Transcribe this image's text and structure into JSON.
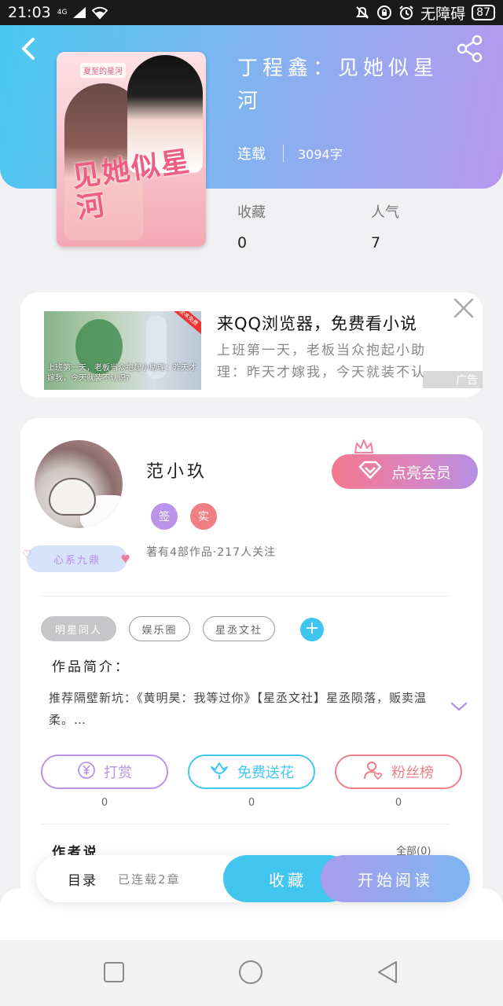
{
  "status_bar": {
    "time": "21:03",
    "network": "4G",
    "accessibility_label": "无障碍",
    "battery": "87"
  },
  "book": {
    "title": "丁程鑫：见她似星河",
    "status": "连载",
    "word_count": "3094字",
    "cover_title": "见她似星河",
    "cover_tag": "夏至的星河"
  },
  "stats": [
    {
      "label": "收藏",
      "value": "0"
    },
    {
      "label": "人气",
      "value": "7"
    }
  ],
  "ad": {
    "title": "来QQ浏览器，免费看小说",
    "description": "上班第一天，老板当众抱起小助理：昨天才嫁我，今天就装不认识?",
    "image_caption": "上班第一天，老板当众抱起小助理：昨天才嫁我，今天就装不认识?",
    "corner_label": "全本免费",
    "label": "广告"
  },
  "author": {
    "name": "范小玖",
    "badge_sign": "签",
    "badge_real": "实",
    "fan_badge": "心系九鼎",
    "meta": "著有4部作品·217人关注",
    "vip_label": "点亮会员",
    "tags": [
      "明星同人",
      "娱乐圈",
      "星丞文社"
    ],
    "add_tag": "+"
  },
  "intro": {
    "title": "作品简介：",
    "text": "推荐隔壁新坑：《黄明昊：我等过你》【星丞文社】星丞陨落，贩卖温柔。…"
  },
  "actions": [
    {
      "label": "打赏",
      "count": "0",
      "color": "#b994e8"
    },
    {
      "label": "免费送花",
      "count": "0",
      "color": "#42c6f0"
    },
    {
      "label": "粉丝榜",
      "count": "0",
      "color": "#ef7f86"
    }
  ],
  "author_says": {
    "title": "作者说",
    "more": "全部(0)"
  },
  "bottom_bar": {
    "catalog": "目录",
    "chapters": "已连载2章",
    "collect": "收藏",
    "read": "开始阅读"
  },
  "icons": {
    "back": "back-icon",
    "share": "share-icon",
    "close": "close-icon",
    "diamond": "diamond-icon",
    "crown": "crown-icon",
    "yuan": "yuan-icon",
    "flower": "flower-icon",
    "fans": "user-heart-icon",
    "chevron": "chevron-down-icon"
  },
  "colors": {
    "header_start": "#49c9f0",
    "header_end": "#b698ee",
    "accent_blue": "#42c6f0",
    "vip_pink": "#f4788c"
  }
}
